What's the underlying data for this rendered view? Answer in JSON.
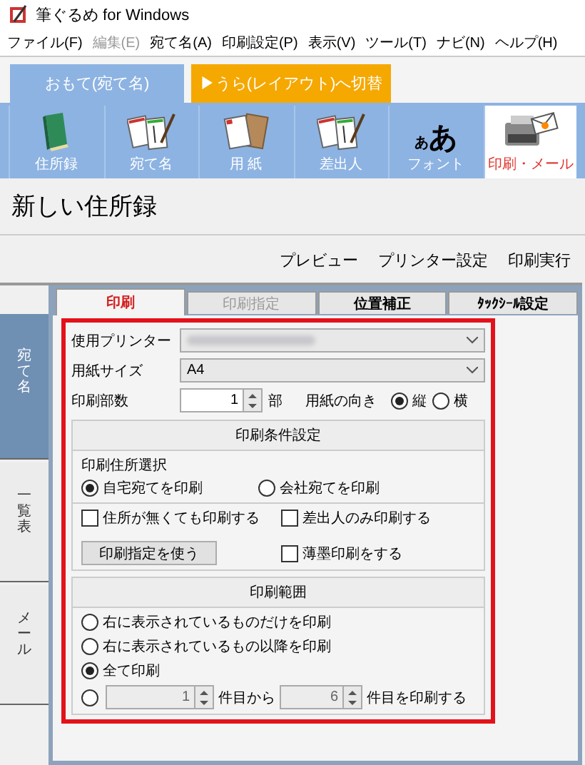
{
  "window": {
    "title": "筆ぐるめ for Windows"
  },
  "menu": [
    {
      "label": "ファイル(F)",
      "disabled": false
    },
    {
      "label": "編集(E)",
      "disabled": true
    },
    {
      "label": "宛て名(A)",
      "disabled": false
    },
    {
      "label": "印刷設定(P)",
      "disabled": false
    },
    {
      "label": "表示(V)",
      "disabled": false
    },
    {
      "label": "ツール(T)",
      "disabled": false
    },
    {
      "label": "ナビ(N)",
      "disabled": false
    },
    {
      "label": "ヘルプ(H)",
      "disabled": false
    }
  ],
  "face_tab": {
    "label": "おもて(宛て名)"
  },
  "switch_button": {
    "label": "▶うら(レイアウト)へ切替"
  },
  "toolbar": [
    {
      "label": "住所録",
      "kind": "book",
      "selected": false
    },
    {
      "label": "宛て名",
      "kind": "cards",
      "selected": false
    },
    {
      "label": "用 紙",
      "kind": "paper",
      "selected": false
    },
    {
      "label": "差出人",
      "kind": "cards",
      "selected": false
    },
    {
      "label": "フォント",
      "kind": "glyph",
      "glyph_small": "あ",
      "glyph_large": "あ",
      "selected": false
    },
    {
      "label": "印刷・メール",
      "kind": "printer",
      "selected": true
    }
  ],
  "heading": "新しい住所録",
  "actions": [
    "プレビュー",
    "プリンター設定",
    "印刷実行"
  ],
  "side_tabs": [
    {
      "label": "宛て名",
      "selected": true
    },
    {
      "label": "一覧表",
      "selected": false
    },
    {
      "label": "メール",
      "selected": false
    }
  ],
  "panel_tabs": [
    {
      "label": "印刷",
      "selected": true,
      "disabled": false
    },
    {
      "label": "印刷指定",
      "selected": false,
      "disabled": true
    },
    {
      "label": "位置補正",
      "selected": false,
      "disabled": false
    },
    {
      "label": "ﾀｯｸｼｰﾙ設定",
      "selected": false,
      "disabled": false
    }
  ],
  "form": {
    "printer": {
      "label": "使用プリンター",
      "redacted": true
    },
    "paper_size": {
      "label": "用紙サイズ",
      "value": "A4"
    },
    "copies": {
      "label": "印刷部数",
      "value": "1",
      "unit": "部"
    },
    "orientation": {
      "label": "用紙の向き",
      "options": [
        {
          "label": "縦",
          "selected": true
        },
        {
          "label": "横",
          "selected": false
        }
      ]
    }
  },
  "conditions": {
    "title": "印刷条件設定",
    "address_label": "印刷住所選択",
    "address_options": [
      {
        "label": "自宅宛てを印刷",
        "selected": true
      },
      {
        "label": "会社宛てを印刷",
        "selected": false
      }
    ],
    "checks": [
      {
        "label": "住所が無くても印刷する",
        "checked": false
      },
      {
        "label": "差出人のみ印刷する",
        "checked": false
      },
      {
        "label": "薄墨印刷をする",
        "checked": false
      }
    ],
    "button": "印刷指定を使う"
  },
  "range": {
    "title": "印刷範囲",
    "options": [
      {
        "kind": "plain",
        "label": "右に表示されているものだけを印刷",
        "selected": false
      },
      {
        "kind": "plain",
        "label": "右に表示されているもの以降を印刷",
        "selected": false
      },
      {
        "kind": "plain",
        "label": "全て印刷",
        "selected": true
      },
      {
        "kind": "range",
        "selected": false,
        "disabled": true,
        "from": "1",
        "from_suffix": "件目から",
        "to": "6",
        "to_suffix": "件目を印刷する"
      }
    ]
  }
}
